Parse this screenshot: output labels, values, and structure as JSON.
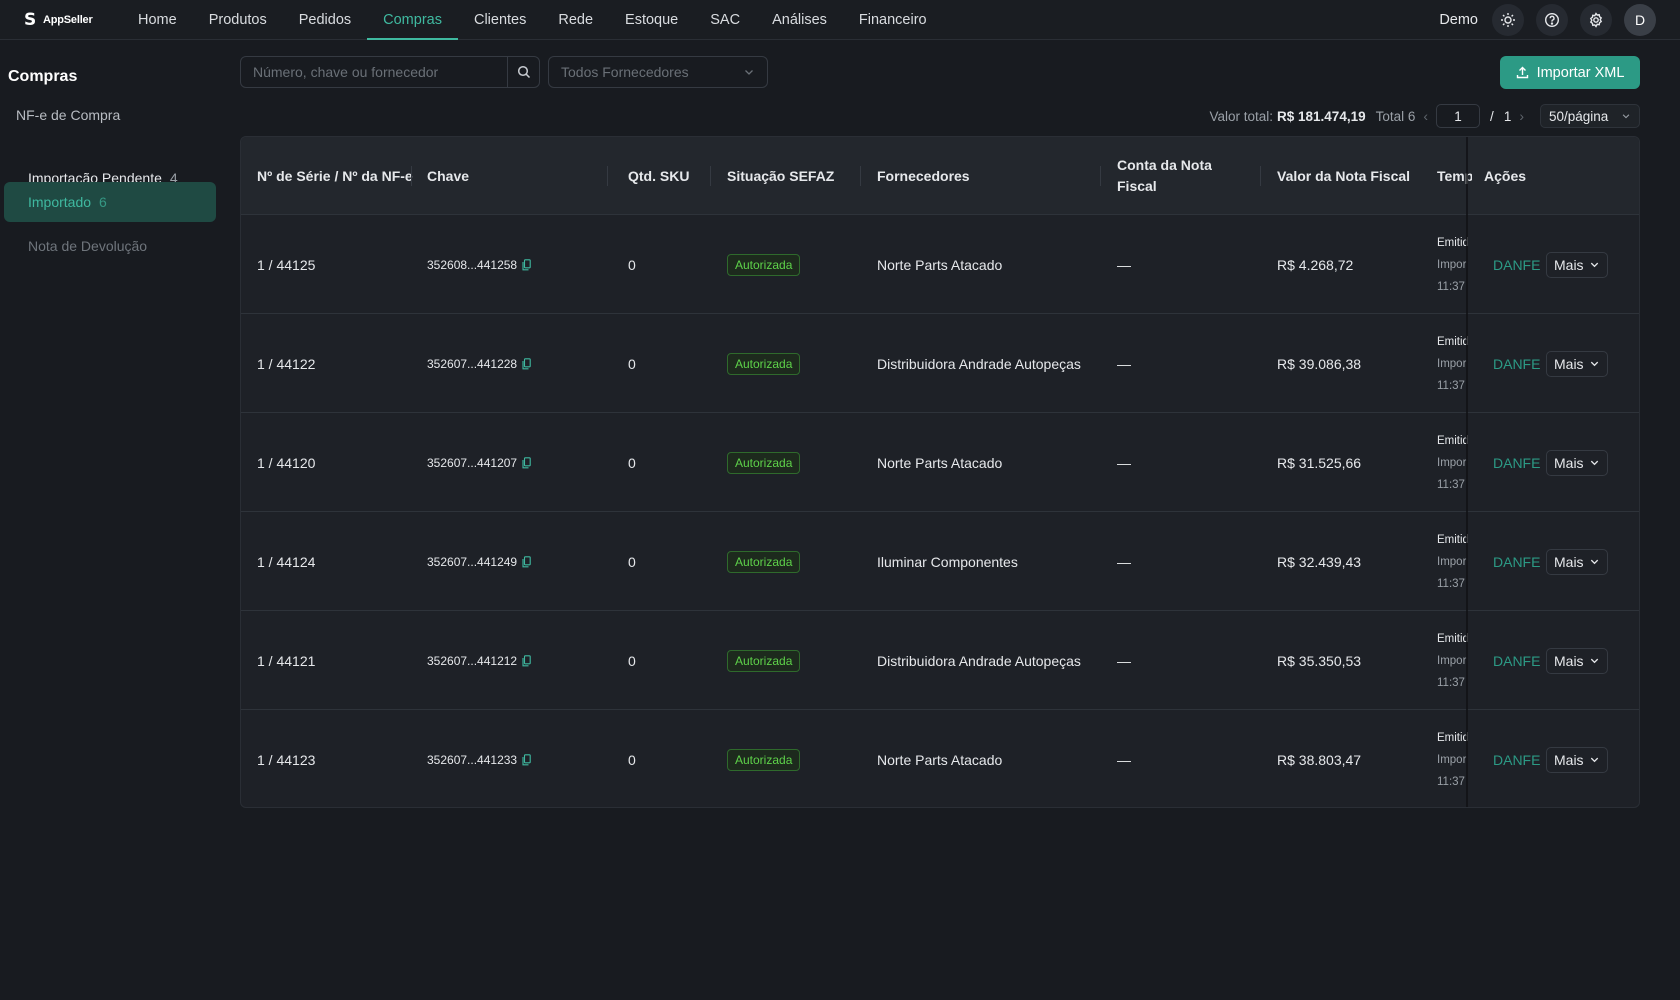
{
  "brand": {
    "name": "AppSeller"
  },
  "nav": {
    "items": [
      "Home",
      "Produtos",
      "Pedidos",
      "Compras",
      "Clientes",
      "Rede",
      "Estoque",
      "SAC",
      "Análises",
      "Financeiro"
    ],
    "active": "Compras"
  },
  "topbar": {
    "user_label": "Demo",
    "avatar_initial": "D",
    "icons": [
      "sun-icon",
      "help-icon",
      "gear-icon"
    ]
  },
  "sidebar": {
    "title": "Compras",
    "group": "NF-e de Compra",
    "items": [
      {
        "label": "Importação Pendente",
        "count": "4"
      },
      {
        "label": "Importado",
        "count": "6"
      },
      {
        "label": "Nota de Devolução",
        "count": ""
      }
    ]
  },
  "filters": {
    "search_placeholder": "Número, chave ou fornecedor",
    "supplier_select": "Todos Fornecedores",
    "import_button": "Importar XML"
  },
  "pagination": {
    "total_value_label": "Valor total:",
    "total_value": "R$ 181.474,19",
    "total_label": "Total 6",
    "current_page": "1",
    "separator": "/",
    "page_count": "1",
    "per_page": "50/página"
  },
  "table": {
    "columns": {
      "serie": "Nº de Série / Nº da NF-e",
      "chave": "Chave",
      "qtd": "Qtd. SKU",
      "sefaz": "Situação SEFAZ",
      "fornecedores": "Fornecedores",
      "conta": "Conta da Nota Fiscal",
      "valor": "Valor da Nota Fiscal",
      "tempo": "Temp",
      "acoes": "Ações"
    },
    "rows": [
      {
        "serie": "1 / 44125",
        "chave": "352608...441258",
        "qtd": "0",
        "sefaz": "Autorizada",
        "fornecedor": "Norte Parts Atacado",
        "conta": "—",
        "valor": "R$ 4.268,72",
        "t1": "Emitid",
        "t2": "Impor",
        "t3": "11:37",
        "danfe": "DANFE",
        "mais": "Mais"
      },
      {
        "serie": "1 / 44122",
        "chave": "352607...441228",
        "qtd": "0",
        "sefaz": "Autorizada",
        "fornecedor": "Distribuidora Andrade Autopeças",
        "conta": "—",
        "valor": "R$ 39.086,38",
        "t1": "Emitid",
        "t2": "Impor",
        "t3": "11:37",
        "danfe": "DANFE",
        "mais": "Mais"
      },
      {
        "serie": "1 / 44120",
        "chave": "352607...441207",
        "qtd": "0",
        "sefaz": "Autorizada",
        "fornecedor": "Norte Parts Atacado",
        "conta": "—",
        "valor": "R$ 31.525,66",
        "t1": "Emitid",
        "t2": "Impor",
        "t3": "11:37",
        "danfe": "DANFE",
        "mais": "Mais"
      },
      {
        "serie": "1 / 44124",
        "chave": "352607...441249",
        "qtd": "0",
        "sefaz": "Autorizada",
        "fornecedor": "Iluminar Componentes",
        "conta": "—",
        "valor": "R$ 32.439,43",
        "t1": "Emitid",
        "t2": "Impor",
        "t3": "11:37",
        "danfe": "DANFE",
        "mais": "Mais"
      },
      {
        "serie": "1 / 44121",
        "chave": "352607...441212",
        "qtd": "0",
        "sefaz": "Autorizada",
        "fornecedor": "Distribuidora Andrade Autopeças",
        "conta": "—",
        "valor": "R$ 35.350,53",
        "t1": "Emitid",
        "t2": "Impor",
        "t3": "11:37",
        "danfe": "DANFE",
        "mais": "Mais"
      },
      {
        "serie": "1 / 44123",
        "chave": "352607...441233",
        "qtd": "0",
        "sefaz": "Autorizada",
        "fornecedor": "Norte Parts Atacado",
        "conta": "—",
        "valor": "R$ 38.803,47",
        "t1": "Emitid",
        "t2": "Impor",
        "t3": "11:37",
        "danfe": "DANFE",
        "mais": "Mais"
      }
    ]
  },
  "colors": {
    "accent": "#3fb9a0",
    "button": "#2c9a85",
    "badge_green": "#5ed24a",
    "background": "#181b20"
  }
}
